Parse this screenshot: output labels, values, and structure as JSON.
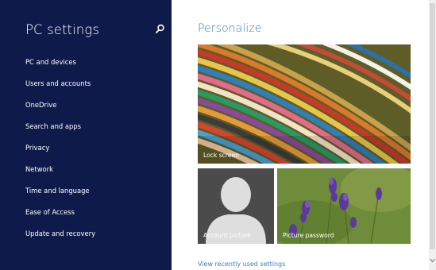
{
  "sidebar": {
    "title": "PC settings",
    "search_icon": "search-icon",
    "items": [
      {
        "label": "PC and devices"
      },
      {
        "label": "Users and accounts"
      },
      {
        "label": "OneDrive"
      },
      {
        "label": "Search and apps"
      },
      {
        "label": "Privacy"
      },
      {
        "label": "Network"
      },
      {
        "label": "Time and language"
      },
      {
        "label": "Ease of Access"
      },
      {
        "label": "Update and recovery"
      }
    ]
  },
  "main": {
    "title": "Personalize",
    "tiles": {
      "lock_screen": {
        "label": "Lock screen"
      },
      "account_picture": {
        "label": "Account picture"
      },
      "picture_password": {
        "label": "Picture password"
      }
    },
    "recent_link": "View recently used settings"
  },
  "colors": {
    "sidebar_bg": "#0e1a4a",
    "accent": "#3a7fc4",
    "text_on_dark": "#ffffff"
  }
}
